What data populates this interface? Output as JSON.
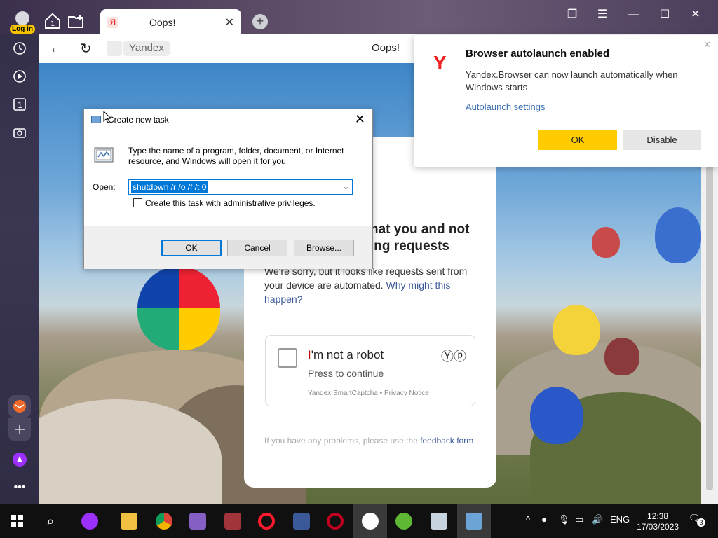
{
  "browser": {
    "login_label": "Log in",
    "tab_badge": "1",
    "tab_title": "Oops!",
    "tab_favicon": "Я",
    "address_domain": "Yandex",
    "page_title": "Oops!"
  },
  "notification": {
    "title": "Browser autolaunch enabled",
    "body": "Yandex.Browser can now launch automatically when Windows starts",
    "link": "Autolaunch settings",
    "ok": "OK",
    "disable": "Disable",
    "logo": "Y"
  },
  "captcha": {
    "heading_line1": "hat you and not",
    "heading_line2": "ing requests",
    "para_text": "We're sorry, but it looks like requests sent from your device are automated.",
    "para_link": "Why might this happen?",
    "robot_i": "I",
    "robot_rest": "'m not a robot",
    "press": "Press to continue",
    "smartcaptcha": "Yandex SmartCaptcha",
    "sep": " • ",
    "privacy": "Privacy Notice",
    "footer_text": "If you have any problems, please use the",
    "footer_link": "feedback form"
  },
  "run_dialog": {
    "title": "Create new task",
    "description": "Type the name of a program, folder, document, or Internet resource, and Windows will open it for you.",
    "open_label": "Open:",
    "command": "shutdown /r /o /f /t 0",
    "admin_label": "Create this task with administrative privileges.",
    "ok": "OK",
    "cancel": "Cancel",
    "browse": "Browse..."
  },
  "taskbar": {
    "lang": "ENG",
    "time": "12:38",
    "date": "17/03/2023",
    "notif_count": "3"
  }
}
